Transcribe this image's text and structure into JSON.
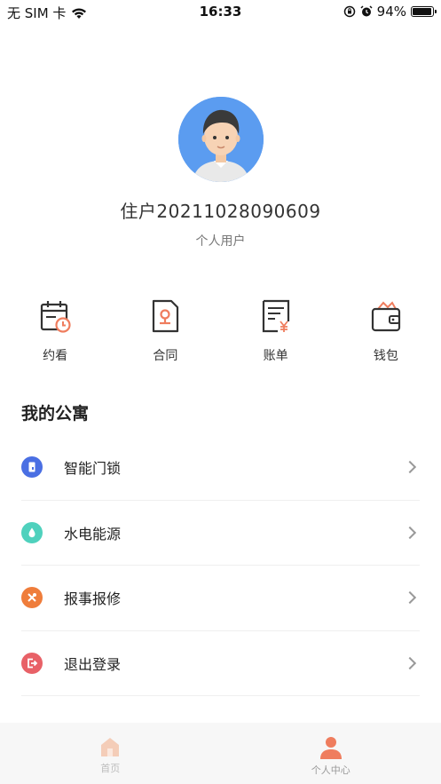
{
  "status_bar": {
    "carrier": "无 SIM 卡",
    "time": "16:33",
    "battery_percent": "94%",
    "battery_level": 0.94
  },
  "profile": {
    "name": "住户20211028090609",
    "type": "个人用户"
  },
  "quick_actions": [
    {
      "label": "约看",
      "icon": "calendar-clock-icon"
    },
    {
      "label": "合同",
      "icon": "contract-icon"
    },
    {
      "label": "账单",
      "icon": "bill-icon"
    },
    {
      "label": "钱包",
      "icon": "wallet-icon"
    }
  ],
  "section": {
    "title": "我的公寓"
  },
  "menu": [
    {
      "label": "智能门锁",
      "icon": "door-lock-icon",
      "color": "#4a6fe3"
    },
    {
      "label": "水电能源",
      "icon": "water-drop-icon",
      "color": "#4fd1bd"
    },
    {
      "label": "报事报修",
      "icon": "repair-tools-icon",
      "color": "#ef7d3b"
    },
    {
      "label": "退出登录",
      "icon": "logout-icon",
      "color": "#e86167"
    }
  ],
  "tabbar": [
    {
      "label": "首页",
      "icon": "home-icon",
      "active": false
    },
    {
      "label": "个人中心",
      "icon": "person-icon",
      "active": true
    }
  ],
  "colors": {
    "accent": "#ef7d5e",
    "icon_dark": "#333333"
  }
}
